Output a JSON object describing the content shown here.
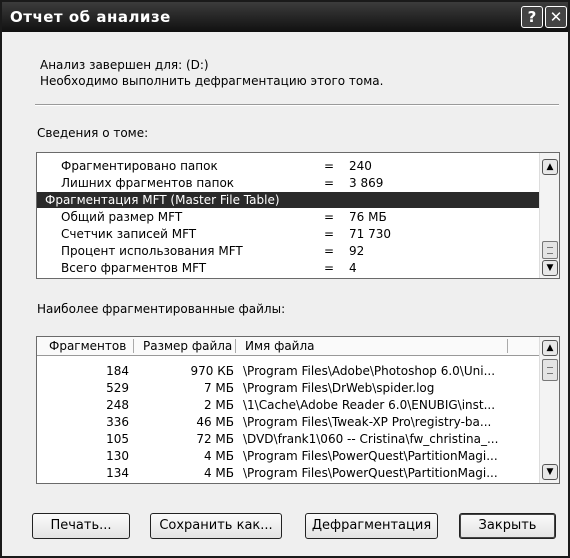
{
  "window": {
    "title": "Отчет об анализе",
    "help_glyph": "?",
    "close_glyph": "✕"
  },
  "summary": {
    "line1": "Анализ завершен для: (D:)",
    "line2": "Необходимо выполнить дефрагментацию этого тома."
  },
  "volume": {
    "heading": "Сведения о томе:",
    "rows": [
      {
        "label": "Фрагментировано папок",
        "eq": "=",
        "value": "240"
      },
      {
        "label": "Лишних фрагментов папок",
        "eq": "=",
        "value": "3 869"
      },
      {
        "label": "Фрагментация MFT (Master File Table)",
        "eq": "",
        "value": ""
      },
      {
        "label": "Общий размер MFT",
        "eq": "=",
        "value": "76 МБ"
      },
      {
        "label": "Счетчик записей MFT",
        "eq": "=",
        "value": "71 730"
      },
      {
        "label": "Процент использования MFT",
        "eq": "=",
        "value": "92"
      },
      {
        "label": "Всего фрагментов MFT",
        "eq": "=",
        "value": "4"
      }
    ]
  },
  "files": {
    "heading": "Наиболее фрагментированные файлы:",
    "columns": [
      "Фрагментов",
      "Размер файла",
      "Имя файла"
    ],
    "rows": [
      {
        "fragments": "184",
        "size": "970 КБ",
        "name": "\\Program Files\\Adobe\\Photoshop 6.0\\Uni..."
      },
      {
        "fragments": "529",
        "size": "7 МБ",
        "name": "\\Program Files\\DrWeb\\spider.log"
      },
      {
        "fragments": "248",
        "size": "2 МБ",
        "name": "\\1\\Cache\\Adobe Reader 6.0\\ENUBIG\\inst..."
      },
      {
        "fragments": "336",
        "size": "46 МБ",
        "name": "\\Program Files\\Tweak-XP Pro\\registry-ba..."
      },
      {
        "fragments": "105",
        "size": "72 МБ",
        "name": "\\DVD\\frank1\\060 -- Cristina\\fw_christina_..."
      },
      {
        "fragments": "130",
        "size": "4 МБ",
        "name": "\\Program Files\\PowerQuest\\PartitionMagi..."
      },
      {
        "fragments": "134",
        "size": "4 МБ",
        "name": "\\Program Files\\PowerQuest\\PartitionMagi..."
      }
    ]
  },
  "buttons": {
    "print": "Печать...",
    "save": "Сохранить как...",
    "defrag": "Дефрагментация",
    "close": "Закрыть"
  },
  "scroll_glyphs": {
    "up": "▲",
    "down": "▼"
  }
}
